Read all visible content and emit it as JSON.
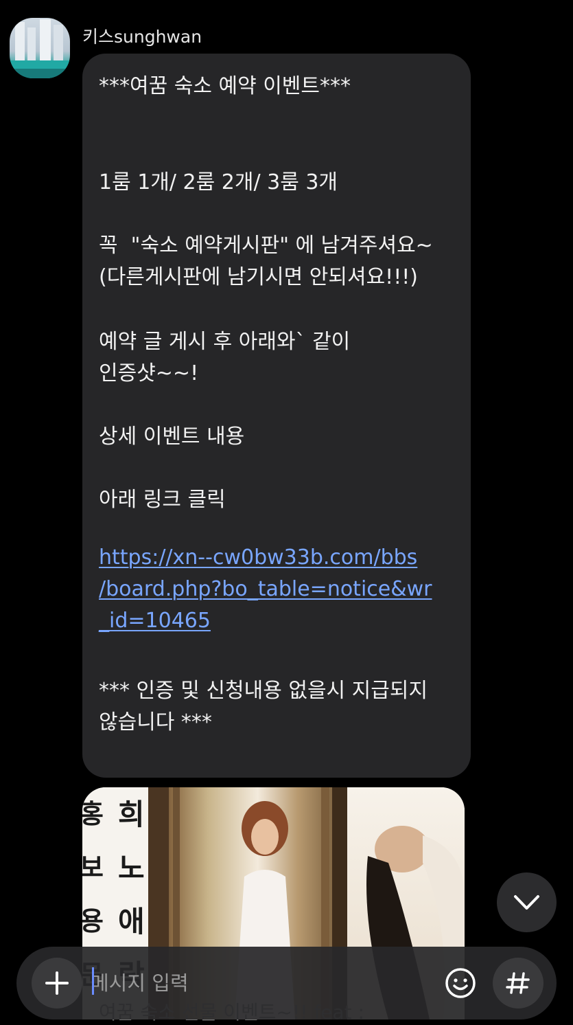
{
  "sender": {
    "name": "키스sunghwan",
    "avatar_icon": "profile-photo"
  },
  "message": {
    "lines": [
      "***여꿈 숙소 예약 이벤트***",
      "1룸 1개/ 2룸 2개/ 3룸 3개",
      "꼭  \"숙소 예약게시판\" 에 남겨주셔요~",
      "(다른게시판에 남기시면 안되셔요!!!)",
      "예약 글 게시 후 아래와` 같이",
      "인증샷~~!",
      "상세 이벤트 내용",
      "아래 링크 클릭",
      "*** 인증 및 신청내용 없을시 지급되지",
      "않습니다 ***"
    ],
    "link_lines": [
      "https://xn--cw0bw33b.com/bbs",
      "/board.php?bo_table=notice&wr",
      "_id=10465"
    ],
    "link_color": "#79a6ff"
  },
  "image_message": {
    "overlay_chars_left": [
      "홍",
      "보",
      "용",
      "문"
    ],
    "overlay_chars_mid": [
      "희",
      "노",
      "애",
      "락"
    ]
  },
  "next_message_preview": "여꿈 숙소 선물 이벤트~!! feat :",
  "composer": {
    "placeholder": "메시지 입력",
    "plus_icon": "plus-icon",
    "emoji_icon": "emoji-icon",
    "hashtag_icon": "hashtag-icon"
  },
  "scroll_down_icon": "chevron-down-icon",
  "colors": {
    "background": "#000000",
    "bubble": "#262628",
    "accent": "#6a8cff"
  }
}
